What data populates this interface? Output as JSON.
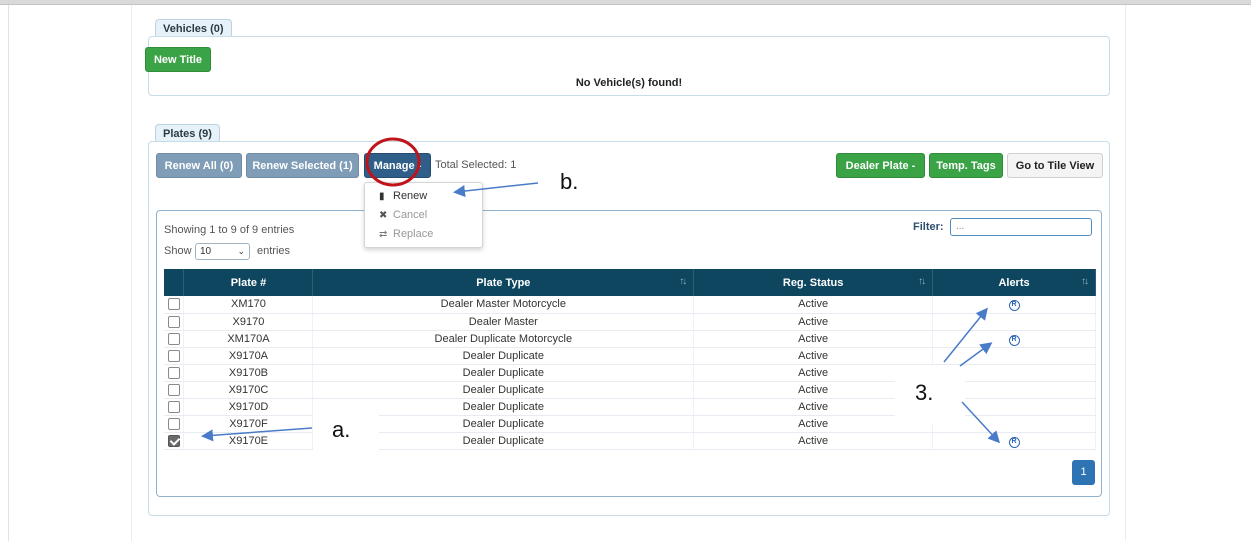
{
  "vehicles": {
    "tab_label": "Vehicles (0)",
    "new_title_label": "New Title",
    "empty_message": "No Vehicle(s) found!"
  },
  "plates": {
    "tab_label": "Plates (9)",
    "renew_all_label": "Renew All (0)",
    "renew_selected_label": "Renew Selected (1)",
    "manage_label": "Manage -",
    "total_selected": "Total Selected: 1",
    "dealer_plate_label": "Dealer Plate -",
    "temp_tags_label": "Temp. Tags",
    "tile_view_label": "Go to Tile View",
    "manage_menu": {
      "renew": "Renew",
      "cancel": "Cancel",
      "replace": "Replace"
    },
    "showing_text": "Showing 1 to 9 of 9 entries",
    "show_label": "Show",
    "page_size": "10",
    "entries_label": "entries",
    "filter_label": "Filter:",
    "filter_placeholder": "...",
    "columns": [
      "Plate #",
      "Plate Type",
      "Reg. Status",
      "Alerts"
    ],
    "rows": [
      {
        "plate": "XM170",
        "type": "Dealer Master Motorcycle",
        "status": "Active",
        "alert": true,
        "checked": false
      },
      {
        "plate": "X9170",
        "type": "Dealer Master",
        "status": "Active",
        "alert": false,
        "checked": false
      },
      {
        "plate": "XM170A",
        "type": "Dealer Duplicate Motorcycle",
        "status": "Active",
        "alert": true,
        "checked": false
      },
      {
        "plate": "X9170A",
        "type": "Dealer Duplicate",
        "status": "Active",
        "alert": false,
        "checked": false
      },
      {
        "plate": "X9170B",
        "type": "Dealer Duplicate",
        "status": "Active",
        "alert": false,
        "checked": false
      },
      {
        "plate": "X9170C",
        "type": "Dealer Duplicate",
        "status": "Active",
        "alert": false,
        "checked": false
      },
      {
        "plate": "X9170D",
        "type": "Dealer Duplicate",
        "status": "Active",
        "alert": false,
        "checked": false
      },
      {
        "plate": "X9170F",
        "type": "Dealer Duplicate",
        "status": "Active",
        "alert": false,
        "checked": false
      },
      {
        "plate": "X9170E",
        "type": "Dealer Duplicate",
        "status": "Active",
        "alert": true,
        "checked": true
      }
    ],
    "current_page": "1"
  },
  "annotations": {
    "a": "a.",
    "b": "b.",
    "c": "3."
  },
  "colors": {
    "header_bg": "#0e4660",
    "green_button": "#3aa346",
    "steel_button": "#7f9db6",
    "navy_button": "#2f5f89",
    "highlight_circle": "#c0141b",
    "arrow": "#4a7bc8",
    "alert_icon": "#2a64b3"
  }
}
